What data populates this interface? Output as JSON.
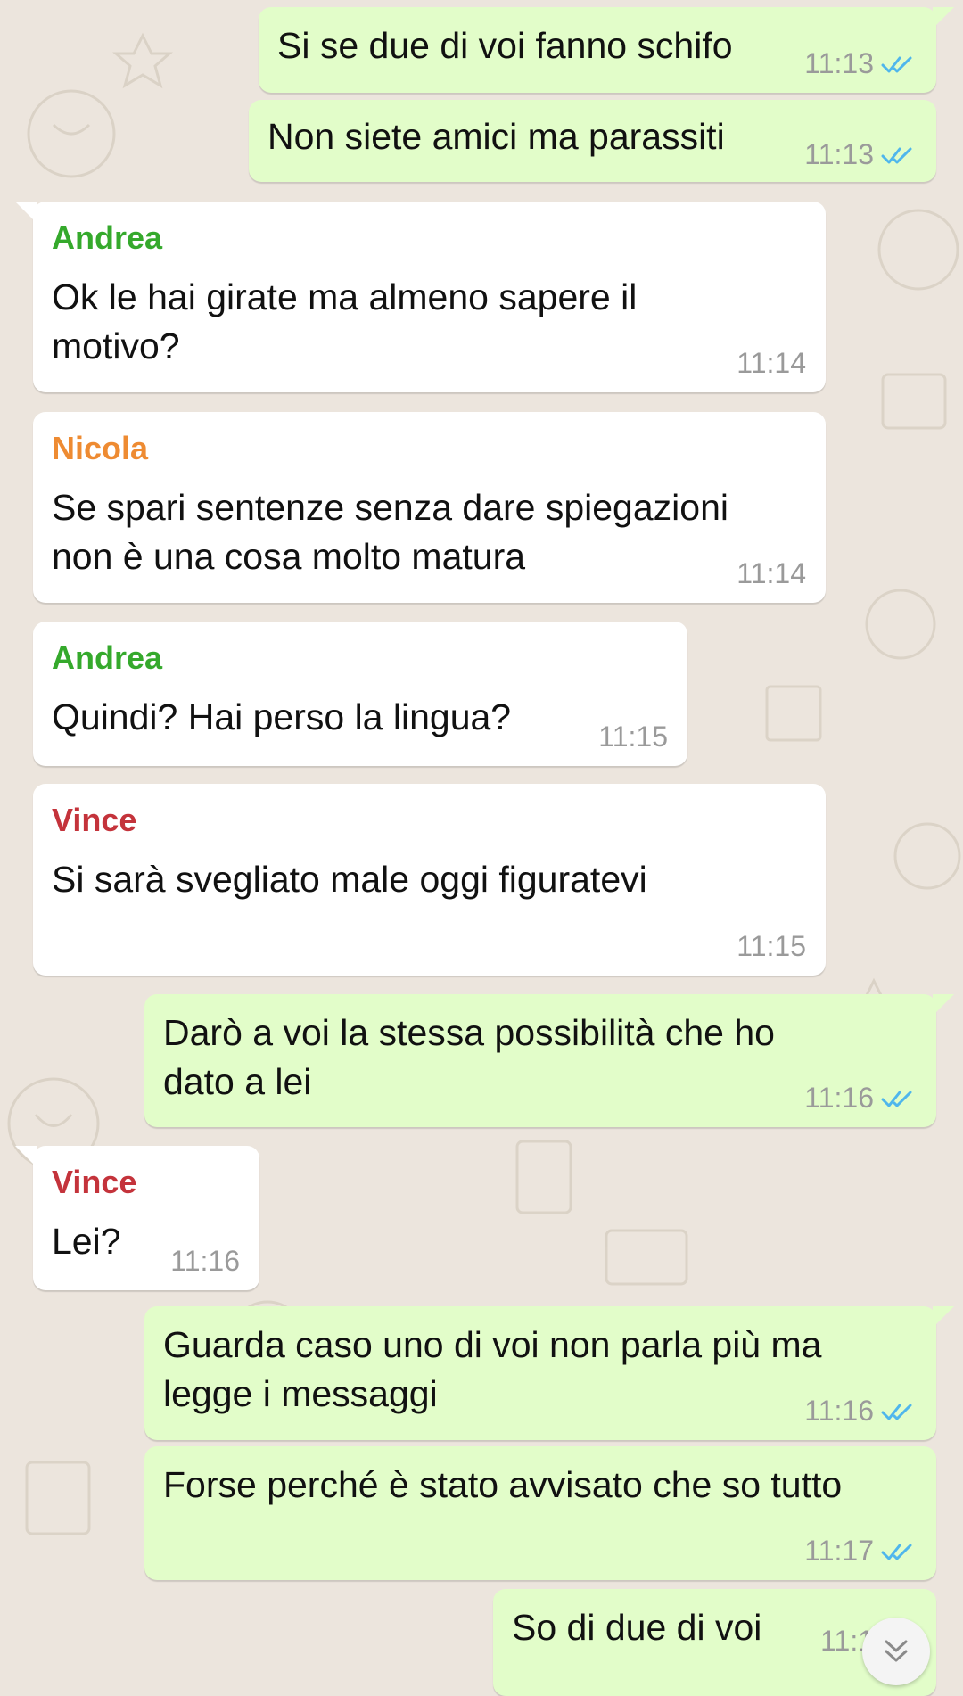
{
  "colors": {
    "outgoing_bubble": "#e2fdc9",
    "incoming_bubble": "#ffffff",
    "wallpaper": "#ece5dd",
    "read_ticks": "#4fb6ec",
    "sender_andrea": "#35a92c",
    "sender_nicola": "#ee8b32",
    "sender_vince": "#c4333b",
    "timestamp": "#9a9a9a"
  },
  "messages": [
    {
      "direction": "outgoing",
      "lines": [
        "Si se due di voi fanno schifo"
      ],
      "time": "11:13",
      "status": "read-double-check-icon"
    },
    {
      "direction": "outgoing",
      "lines": [
        "Non siete amici ma parassiti"
      ],
      "time": "11:13",
      "status": "read-double-check-icon"
    },
    {
      "direction": "incoming",
      "sender": "Andrea",
      "lines": [
        "Ok le hai girate ma almeno sapere il",
        "motivo?"
      ],
      "time": "11:14"
    },
    {
      "direction": "incoming",
      "sender": "Nicola",
      "lines": [
        "Se spari sentenze senza dare spiegazioni",
        "non è una cosa molto matura"
      ],
      "time": "11:14"
    },
    {
      "direction": "incoming",
      "sender": "Andrea",
      "lines": [
        "Quindi? Hai perso la lingua?"
      ],
      "time": "11:15"
    },
    {
      "direction": "incoming",
      "sender": "Vince",
      "lines": [
        "Si sarà svegliato male oggi figuratevi"
      ],
      "time": "11:15"
    },
    {
      "direction": "outgoing",
      "lines": [
        "Darò a voi la stessa possibilità che ho",
        "dato a lei"
      ],
      "time": "11:16",
      "status": "read-double-check-icon"
    },
    {
      "direction": "incoming",
      "sender": "Vince",
      "lines": [
        "Lei?"
      ],
      "time": "11:16"
    },
    {
      "direction": "outgoing",
      "lines": [
        "Guarda caso uno di voi non parla più ma",
        "legge i messaggi"
      ],
      "time": "11:16",
      "status": "read-double-check-icon"
    },
    {
      "direction": "outgoing",
      "lines": [
        "Forse perché è stato avvisato che so tutto"
      ],
      "time": "11:17",
      "status": "read-double-check-icon"
    },
    {
      "direction": "outgoing",
      "lines": [
        "So di due di voi"
      ],
      "time": "11:1",
      "status": "read-double-check-icon"
    }
  ],
  "scroll_button": {
    "icon": "double-chevron-down-icon"
  }
}
